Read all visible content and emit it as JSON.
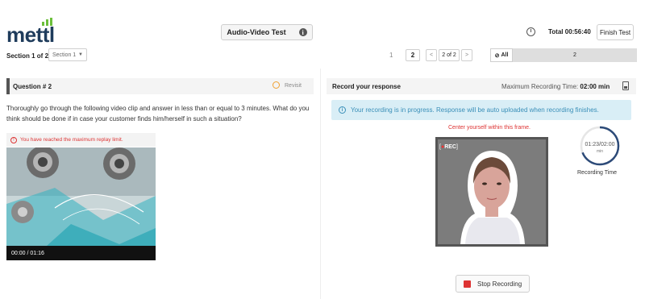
{
  "header": {
    "logo": "mettl",
    "test_title": "Audio-Video Test",
    "total_time": "Total 00:56:40",
    "finish_label": "Finish Test"
  },
  "section_bar": {
    "section_label": "Section 1 of 2",
    "section_select": "Section 1",
    "page_prev": "1",
    "page_current": "2",
    "prev_label": "<",
    "page_of": "2 of 2",
    "next_label": ">",
    "all_label": "All",
    "question_badge": "2"
  },
  "question": {
    "title": "Question # 2",
    "revisit": "Revisit",
    "text": "Thoroughly go through the following video clip and answer in less than or equal to 3 minutes. What do you think should be done if in case your customer finds him/herself in such a situation?",
    "warning": "You have reached the maximum replay limit.",
    "video_time": "00:00 / 01:16"
  },
  "response": {
    "title": "Record your response",
    "max_label": "Maximum Recording Time:",
    "max_value": "02:00 min",
    "info": "Your recording is in progress. Response will be auto uploaded when recording finishes.",
    "center_hint": "Center yourself within this frame.",
    "rec_dot": "●",
    "rec_label": "REC",
    "timer_value": "01:23/02:00",
    "timer_unit": "min",
    "timer_progress": 0.69,
    "timer_caption": "Recording Time",
    "stop_label": "Stop Recording"
  },
  "colors": {
    "accent_red": "#d33333",
    "info_blue": "#3a8fb8",
    "logo_green": "#6cbf3b",
    "logo_navy": "#1f3c5c"
  }
}
